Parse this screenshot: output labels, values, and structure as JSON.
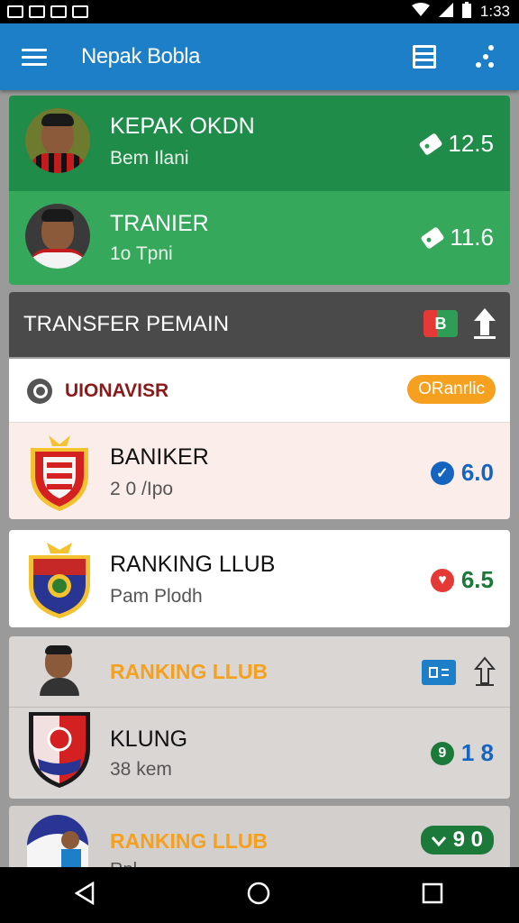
{
  "status_bar": {
    "time": "1:33"
  },
  "app_bar": {
    "title": "Nepak Bobla"
  },
  "players": [
    {
      "name": "KEPAK OKDN",
      "subtitle": "Bem Ilani",
      "value": "12.5"
    },
    {
      "name": "TRANIER",
      "subtitle": "1o Tpni",
      "value": "11.6"
    }
  ],
  "transfer_section": {
    "title": "TRANSFER PEMAIN",
    "icon_label": "B"
  },
  "filter_row": {
    "label": "UIONAVISR",
    "pill": "ORanrlic"
  },
  "clubs": [
    {
      "name": "BANIKER",
      "subtitle": "2 0 /Ipo",
      "value": "6.0",
      "badge": "✓",
      "badge_color": "#1565c0",
      "value_color": "#1565c0"
    },
    {
      "name": "RANKING LLUB",
      "subtitle": "Pam Plodh",
      "value": "6.5",
      "badge": "♥",
      "badge_color": "#e53935",
      "value_color": "#1b7a3a"
    }
  ],
  "ranking_group": {
    "header": "RANKING LLUB",
    "club_name": "KLUNG",
    "club_subtitle": "38 kem",
    "club_value": "1 8",
    "club_badge": "9"
  },
  "last_row": {
    "header": "RANKING LLUB",
    "value": "9 0",
    "subtitle": "Rnl..."
  },
  "colors": {
    "app_bar": "#1e7fc9",
    "green_dark": "#1f8c4a",
    "green_light": "#36a85c",
    "orange": "#f5a01e"
  }
}
